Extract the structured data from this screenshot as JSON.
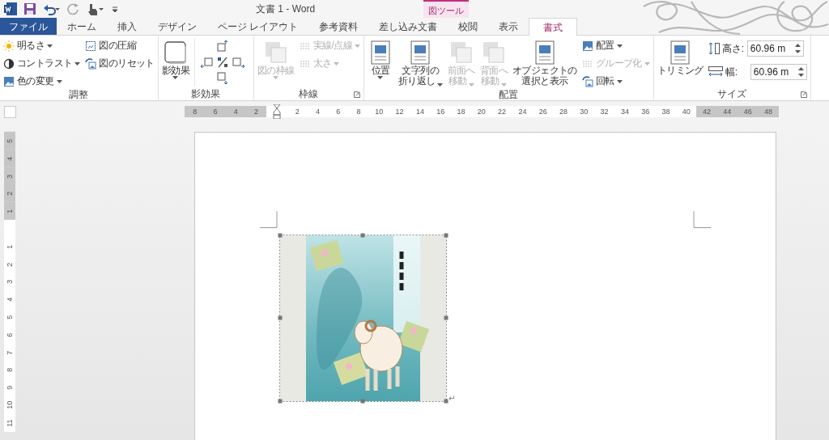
{
  "window": {
    "title": "文書 1 - Word"
  },
  "contextual_tab": {
    "label": "図ツール"
  },
  "tabs": [
    {
      "label": "ファイル",
      "kind": "file",
      "selected": false
    },
    {
      "label": "ホーム",
      "kind": "tab",
      "selected": false
    },
    {
      "label": "挿入",
      "kind": "tab",
      "selected": false
    },
    {
      "label": "デザイン",
      "kind": "tab",
      "selected": false
    },
    {
      "label": "ページ レイアウト",
      "kind": "tab",
      "selected": false
    },
    {
      "label": "参考資料",
      "kind": "tab",
      "selected": false
    },
    {
      "label": "差し込み文書",
      "kind": "tab",
      "selected": false
    },
    {
      "label": "校閲",
      "kind": "tab",
      "selected": false
    },
    {
      "label": "表示",
      "kind": "tab",
      "selected": false
    },
    {
      "label": "書式",
      "kind": "tab",
      "selected": true
    }
  ],
  "ribbon": {
    "groups": [
      {
        "label": "調整",
        "launcher": false,
        "columns": [
          [
            {
              "kind": "small",
              "label": "明るさ",
              "dropdown": true,
              "disabled": false
            },
            {
              "kind": "small",
              "label": "コントラスト",
              "dropdown": true,
              "disabled": false
            },
            {
              "kind": "small",
              "label": "色の変更",
              "dropdown": true,
              "disabled": false
            }
          ],
          [
            {
              "kind": "small",
              "label": "図の圧縮",
              "dropdown": false,
              "disabled": false
            },
            {
              "kind": "small",
              "label": "図のリセット",
              "dropdown": false,
              "disabled": false
            }
          ]
        ]
      },
      {
        "label": "影効果",
        "launcher": false,
        "columns": [
          [
            {
              "kind": "large",
              "lines": [
                "影効果"
              ],
              "dropdown": true,
              "disabled": false
            }
          ],
          [
            {
              "kind": "nudge"
            }
          ]
        ]
      },
      {
        "label": "枠線",
        "launcher": true,
        "columns": [
          [
            {
              "kind": "large",
              "lines": [
                "図の枠線"
              ],
              "dropdown": true,
              "disabled": true
            }
          ],
          [
            {
              "kind": "small",
              "label": "実線/点線",
              "dropdown": true,
              "disabled": true
            },
            {
              "kind": "small",
              "label": "太さ",
              "dropdown": true,
              "disabled": true
            }
          ]
        ]
      },
      {
        "label": "配置",
        "launcher": false,
        "columns": [
          [
            {
              "kind": "large",
              "lines": [
                "位置"
              ],
              "dropdown": true,
              "disabled": false
            }
          ],
          [
            {
              "kind": "large",
              "lines": [
                "文字列の",
                "折り返し"
              ],
              "dropdown": true,
              "disabled": false
            }
          ],
          [
            {
              "kind": "large",
              "lines": [
                "前面へ",
                "移動"
              ],
              "dropdown": true,
              "disabled": true
            }
          ],
          [
            {
              "kind": "large",
              "lines": [
                "背面へ",
                "移動"
              ],
              "dropdown": true,
              "disabled": true
            }
          ],
          [
            {
              "kind": "large",
              "lines": [
                "オブジェクトの",
                "選択と表示"
              ],
              "dropdown": false,
              "disabled": false
            }
          ],
          [
            {
              "kind": "small",
              "label": "配置",
              "dropdown": true,
              "disabled": false
            },
            {
              "kind": "small",
              "label": "グループ化",
              "dropdown": true,
              "disabled": true
            },
            {
              "kind": "small",
              "label": "回転",
              "dropdown": true,
              "disabled": false
            }
          ]
        ]
      },
      {
        "label": "サイズ",
        "launcher": true,
        "columns": [
          [
            {
              "kind": "large",
              "lines": [
                "トリミング"
              ],
              "dropdown": false,
              "disabled": false
            }
          ],
          [
            {
              "kind": "field",
              "label": "高さ:",
              "value": "60.96 m"
            },
            {
              "kind": "field",
              "label": "幅:",
              "value": "60.96 m"
            }
          ]
        ]
      }
    ]
  },
  "horizontal_ruler": {
    "labels": [
      {
        "text": "8",
        "margin": true
      },
      {
        "text": "6",
        "margin": true
      },
      {
        "text": "4",
        "margin": true
      },
      {
        "text": "2",
        "margin": true
      },
      {
        "text": "2",
        "margin": false
      },
      {
        "text": "4",
        "margin": false
      },
      {
        "text": "6",
        "margin": false
      },
      {
        "text": "8",
        "margin": false
      },
      {
        "text": "10",
        "margin": false
      },
      {
        "text": "12",
        "margin": false
      },
      {
        "text": "14",
        "margin": false
      },
      {
        "text": "16",
        "margin": false
      },
      {
        "text": "18",
        "margin": false
      },
      {
        "text": "20",
        "margin": false
      },
      {
        "text": "22",
        "margin": false
      },
      {
        "text": "24",
        "margin": false
      },
      {
        "text": "26",
        "margin": false
      },
      {
        "text": "28",
        "margin": false
      },
      {
        "text": "30",
        "margin": false
      },
      {
        "text": "32",
        "margin": false
      },
      {
        "text": "34",
        "margin": false
      },
      {
        "text": "36",
        "margin": false
      },
      {
        "text": "38",
        "margin": false
      },
      {
        "text": "40",
        "margin": false
      },
      {
        "text": "42",
        "margin": true
      },
      {
        "text": "44",
        "margin": true
      },
      {
        "text": "46",
        "margin": true
      },
      {
        "text": "48",
        "margin": true
      }
    ]
  },
  "vertical_ruler": {
    "labels": [
      {
        "text": "5",
        "margin": true
      },
      {
        "text": "4",
        "margin": true
      },
      {
        "text": "3",
        "margin": true
      },
      {
        "text": "2",
        "margin": true
      },
      {
        "text": "1",
        "margin": true
      },
      {
        "text": "1",
        "margin": false
      },
      {
        "text": "2",
        "margin": false
      },
      {
        "text": "3",
        "margin": false
      },
      {
        "text": "4",
        "margin": false
      },
      {
        "text": "5",
        "margin": false
      },
      {
        "text": "6",
        "margin": false
      },
      {
        "text": "7",
        "margin": false
      },
      {
        "text": "8",
        "margin": false
      },
      {
        "text": "9",
        "margin": false
      },
      {
        "text": "10",
        "margin": false
      },
      {
        "text": "11",
        "margin": false
      }
    ]
  },
  "document": {
    "paragraph_mark": "↵"
  }
}
